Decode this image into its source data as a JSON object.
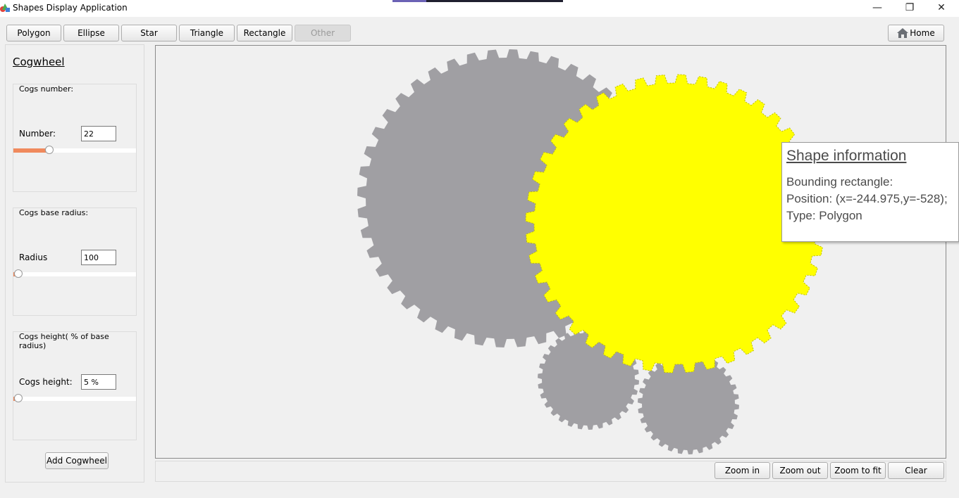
{
  "window": {
    "title": "Shapes Display Application",
    "minimize": "—",
    "restore": "❐",
    "close": "✕"
  },
  "toolbar": {
    "buttons": [
      {
        "label": "Polygon",
        "enabled": true
      },
      {
        "label": "Ellipse",
        "enabled": true
      },
      {
        "label": "Star",
        "enabled": true
      },
      {
        "label": "Triangle",
        "enabled": true
      },
      {
        "label": "Rectangle",
        "enabled": true
      },
      {
        "label": "Other",
        "enabled": false
      }
    ],
    "home_label": "Home",
    "home_icon": "home-icon"
  },
  "panel": {
    "title": "Cogwheel",
    "cogs_number": {
      "group_label": "Cogs number:",
      "field_label": "Number:",
      "value": "22",
      "slider_level": 0.25
    },
    "base_radius": {
      "group_label": "Cogs base radius:",
      "field_label": "Radius",
      "value": "100",
      "slider_level": 0.0
    },
    "cogs_height": {
      "group_label": "Cogs height( % of base radius)",
      "field_label": "Cogs height:",
      "value": "5 %",
      "slider_level": 0.0
    },
    "add_button": "Add Cogwheel"
  },
  "tooltip": {
    "title": "Shape information",
    "line1": "Bounding rectangle:",
    "line2": "Position: (x=-244.975,y=-528);",
    "line3": "Type: Polygon"
  },
  "bottom": {
    "zoom_in": "Zoom in",
    "zoom_out": "Zoom out",
    "zoom_fit": "Zoom to fit",
    "clear": "Clear"
  },
  "colors": {
    "gear_gray": "#a09fa3",
    "gear_selected": "#ffff00",
    "slider_fill": "#f08a5d"
  }
}
